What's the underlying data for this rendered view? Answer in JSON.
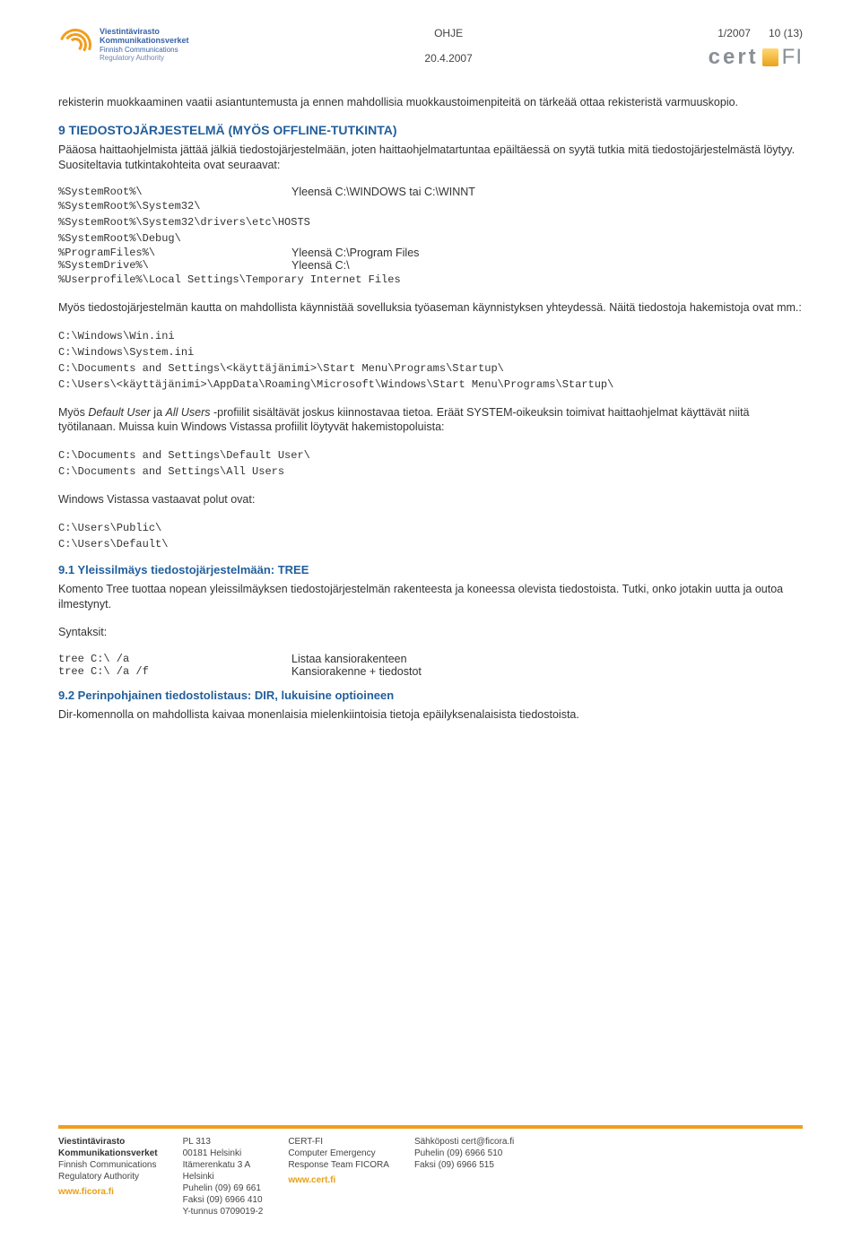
{
  "header": {
    "doc_label": "OHJE",
    "date": "20.4.2007",
    "issue": "1/2007",
    "page": "10 (13)",
    "org": {
      "fi": "Viestintävirasto",
      "sv": "Kommunikationsverket",
      "enA": "Finnish Communications",
      "enB": "Regulatory Authority"
    },
    "cert": {
      "left": "cert",
      "right": "FI"
    }
  },
  "p1": "rekisterin muokkaaminen vaatii asiantuntemusta ja ennen mahdollisia muokkaustoimenpiteitä on tärkeää ottaa rekisteristä varmuuskopio.",
  "h9": "9   TIEDOSTOJÄRJESTELMÄ (MYÖS OFFLINE-TUTKINTA)",
  "p2": "Pääosa haittaohjelmista jättää jälkiä tiedostojärjestelmään, joten haittaohjelmatartuntaa epäiltäessä on syytä tutkia mitä tiedostojärjestelmästä löytyy. Suositeltavia tutkintakohteita ovat seuraavat:",
  "env1": {
    "a1": "%SystemRoot%\\",
    "a1v": "Yleensä C:\\WINDOWS tai C:\\WINNT",
    "a2": "%SystemRoot%\\System32\\",
    "a3": "%SystemRoot%\\System32\\drivers\\etc\\HOSTS",
    "a4": "%SystemRoot%\\Debug\\",
    "a5": "%ProgramFiles%\\",
    "a5v": "Yleensä C:\\Program Files",
    "a6": "%SystemDrive%\\",
    "a6v": "Yleensä C:\\",
    "a7": "%Userprofile%\\Local Settings\\Temporary Internet Files"
  },
  "p3": "Myös tiedostojärjestelmän kautta on mahdollista käynnistää sovelluksia työaseman käynnistyksen yhteydessä. Näitä tiedostoja hakemistoja ovat mm.:",
  "paths": {
    "l1": "C:\\Windows\\Win.ini",
    "l2": "C:\\Windows\\System.ini",
    "l3": "C:\\Documents and Settings\\<käyttäjänimi>\\Start Menu\\Programs\\Startup\\",
    "l4": "C:\\Users\\<käyttäjänimi>\\AppData\\Roaming\\Microsoft\\Windows\\Start Menu\\Programs\\Startup\\"
  },
  "p4a": "Myös ",
  "p4du": "Default User",
  "p4b": " ja ",
  "p4au": "All Users",
  "p4c": " -profiilit sisältävät joskus kiinnostavaa tietoa. Eräät SYSTEM-oikeuksin toimivat haittaohjelmat käyttävät niitä työtilanaan. Muissa kuin Windows Vistassa profiilit löytyvät hakemistopoluista:",
  "paths2": {
    "l1": "C:\\Documents and Settings\\Default User\\",
    "l2": "C:\\Documents and Settings\\All Users"
  },
  "p5": "Windows Vistassa vastaavat polut ovat:",
  "paths3": {
    "l1": "C:\\Users\\Public\\",
    "l2": "C:\\Users\\Default\\"
  },
  "h91": "9.1   Yleissilmäys tiedostojärjestelmään: TREE",
  "p6": "Komento Tree tuottaa nopean yleissilmäyksen tiedostojärjestelmän rakenteesta ja koneessa olevista tiedostoista. Tutki, onko jotakin uutta ja outoa ilmestynyt.",
  "syntlabel": "Syntaksit:",
  "synt": {
    "c1": "tree C:\\ /a",
    "c1v": "Listaa kansiorakenteen",
    "c2": "tree C:\\ /a /f",
    "c2v": "Kansiorakenne + tiedostot"
  },
  "h92": "9.2   Perinpohjainen tiedostolistaus: DIR, lukuisine optioineen",
  "p7": "Dir-komennolla on mahdollista kaivaa monenlaisia mielenkiintoisia tietoja epäilyksenalaisista tiedostoista.",
  "footer": {
    "c1": {
      "a": "Viestintävirasto",
      "b": "Kommunikationsverket",
      "c": "Finnish Communications",
      "d": "Regulatory Authority",
      "w": "www.ficora.fi"
    },
    "c2": {
      "a": "PL 313",
      "b": "00181 Helsinki",
      "c": "Itämerenkatu 3 A",
      "d": "Helsinki",
      "e": "Puhelin (09) 69 661",
      "f": "Faksi (09) 6966 410",
      "g": "Y-tunnus 0709019-2"
    },
    "c3": {
      "a": "CERT-FI",
      "b": "Computer Emergency",
      "c": "Response Team FICORA",
      "w": "www.cert.fi"
    },
    "c4": {
      "a": "Sähköposti cert@ficora.fi",
      "b": "Puhelin (09) 6966 510",
      "c": "Faksi (09) 6966 515"
    }
  }
}
